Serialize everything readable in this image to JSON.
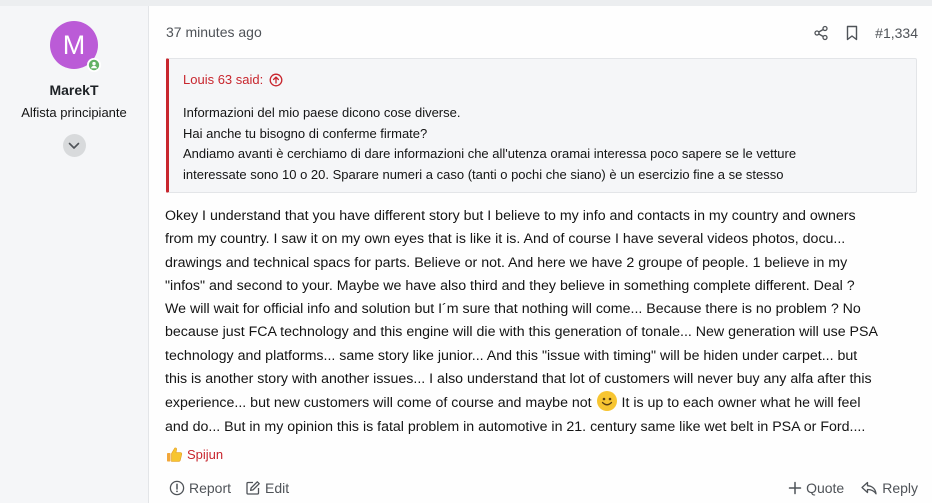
{
  "user": {
    "avatar_letter": "M",
    "avatar_color": "#bb5bd7",
    "name": "MarekT",
    "title": "Alfista principiante"
  },
  "post": {
    "time": "37 minutes ago",
    "number": "#1,334",
    "quote": {
      "author": "Louis 63 said:",
      "lines": [
        "Informazioni del mio paese dicono cose diverse.",
        "Hai anche tu bisogno di conferme firmate?",
        "Andiamo avanti è cerchiamo di dare informazioni che all'utenza oramai interessa poco sapere se le vetture",
        "interessate sono 10 o 20. Sparare numeri a caso (tanti o pochi che siano) è un esercizio fine a se stesso"
      ]
    },
    "body": [
      "Okey I understand that you have different story but I believe to my info and contacts in my country and owners",
      "from my country. I saw it on my own eyes that is like it is. And of course I have several videos photos, docu...",
      "drawings and technical spacs for parts. Believe or not. And here we have 2 groupe of people. 1 believe in my",
      "\"infos\" and second to your. Maybe we have also third and they believe in something complete different. Deal ?",
      "We will wait for official info and solution but I´m sure that nothing will come... Because there is no problem ? No",
      "because just FCA technology and this engine will die with this generation of tonale... New generation will use PSA",
      "technology and platforms... same story like junior... And this \"issue with timing\" will be hiden under carpet... but",
      "this is another story with another issues... I also understand that lot of customers will never buy any alfa after this"
    ],
    "body_line9_before": "experience... but new customers will come of course and maybe not",
    "body_line9_after": " It is up to each owner what he will feel",
    "body_line10": "and do... But in my opinion this is fatal problem in automotive in 21. century same like wet belt in PSA or Ford....",
    "reaction_user": "Spijun",
    "actions": {
      "report": "Report",
      "edit": "Edit",
      "quote": "Quote",
      "reply": "Reply"
    }
  },
  "colors": {
    "accent": "#c8262e",
    "muted": "#4f5358"
  }
}
